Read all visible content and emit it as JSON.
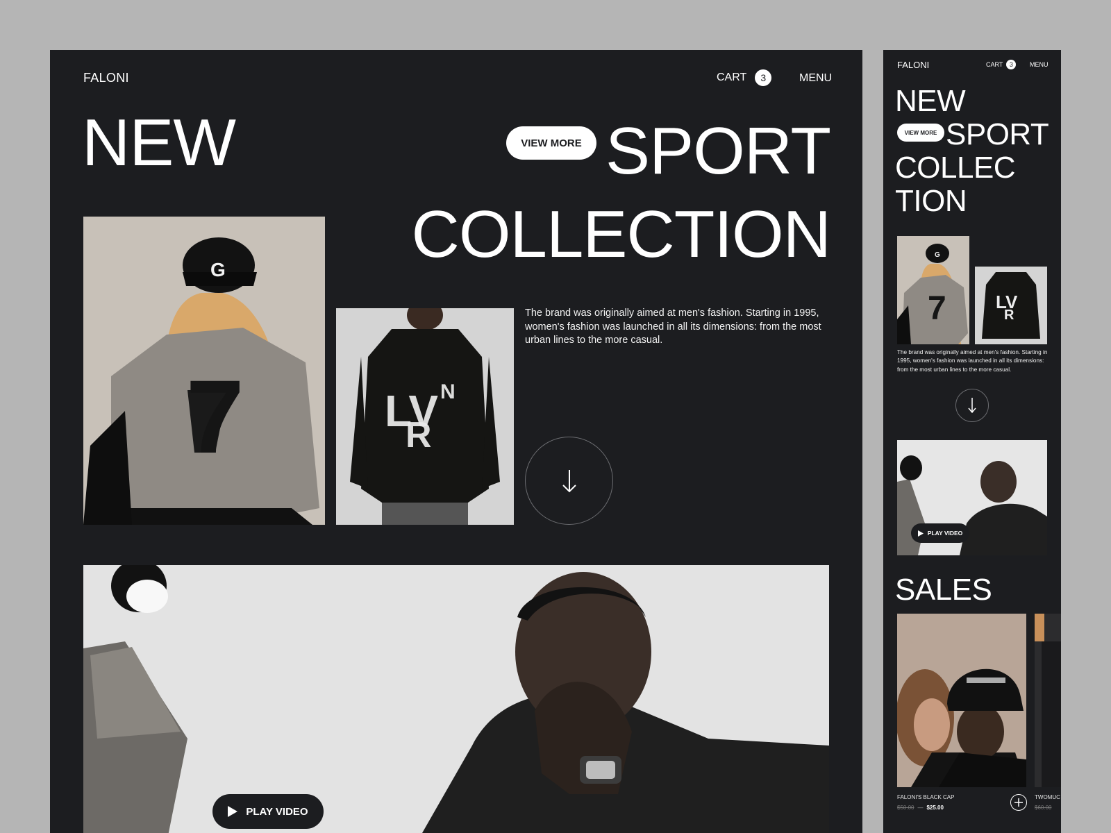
{
  "brand": "FALONI",
  "nav": {
    "cart_label": "CART",
    "cart_count": "3",
    "menu_label": "MENU"
  },
  "hero": {
    "word_new": "NEW",
    "word_sport": "SPORT",
    "word_collection": "COLLECTION",
    "view_more_label": "VIEW MORE",
    "description": "The brand was originally aimed at men's fashion. Starting in 1995, women's fashion was launched in all its dimensions: from the most urban lines to the more casual.",
    "scroll_icon": "arrow-down-icon"
  },
  "video": {
    "play_label": "PLAY VIDEO",
    "play_icon": "play-icon"
  },
  "mobile": {
    "word_new": "NEW",
    "word_sport": "SPORT",
    "word_collec": "COLLEC",
    "word_tion": "TION",
    "sales_title": "SALES",
    "products": [
      {
        "name": "FALONI'S BLACK CAP",
        "old_price": "$50.00",
        "separator": "—",
        "new_price": "$25.00"
      },
      {
        "name": "TWOMUC",
        "old_price": "$60.00"
      }
    ]
  },
  "colors": {
    "background": "#b5b5b5",
    "panel": "#1c1d20",
    "text": "#ffffff"
  }
}
